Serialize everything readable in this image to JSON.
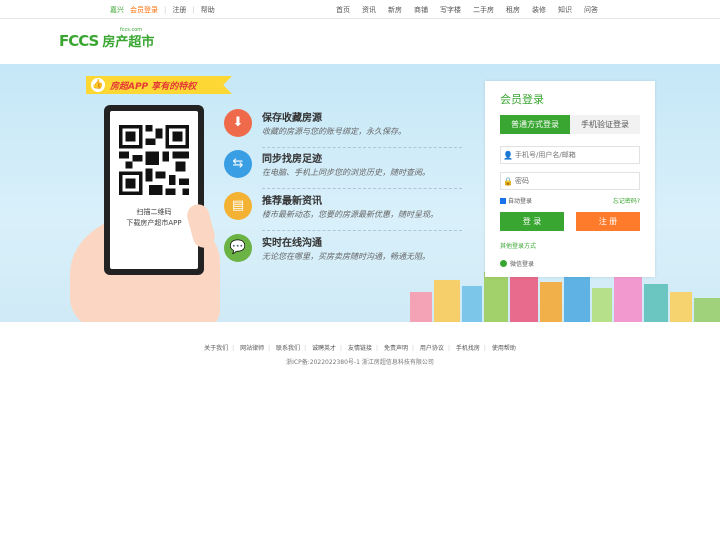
{
  "topbar": {
    "city": "嘉兴",
    "member_login": "会员登录",
    "register": "注册",
    "help": "帮助",
    "nav": [
      "首页",
      "资讯",
      "新房",
      "商铺",
      "写字楼",
      "二手房",
      "租房",
      "装修",
      "知识",
      "问答"
    ]
  },
  "logo": {
    "mark": "FCCS",
    "name": "房产超市",
    "domain": "fccs.com"
  },
  "banner": {
    "promo": "房超APP 享有的特权",
    "qr_caption_1": "扫描二维码",
    "qr_caption_2": "下载房产超市APP",
    "features": [
      {
        "title": "保存收藏房源",
        "desc": "收藏的房源与您的账号绑定，永久保存。",
        "icon": "download-icon",
        "color": "#ef6a4b"
      },
      {
        "title": "同步找房足迹",
        "desc": "在电脑、手机上同步您的浏览历史，随时查阅。",
        "icon": "sync-icon",
        "color": "#3a9ee4"
      },
      {
        "title": "推荐最新资讯",
        "desc": "楼市最新动态，您要的房源最新优惠，随时呈现。",
        "icon": "news-icon",
        "color": "#f3b233"
      },
      {
        "title": "实时在线沟通",
        "desc": "无论您在哪里，买房卖房随时沟通，畅通无阻。",
        "icon": "chat-icon",
        "color": "#6ab344"
      }
    ]
  },
  "login": {
    "title": "会员登录",
    "tab_normal": "普通方式登录",
    "tab_phone": "手机验证登录",
    "username_placeholder": "手机号/用户名/邮箱",
    "password_placeholder": "密码",
    "auto_login": "自动登录",
    "forgot": "忘记密码?",
    "login_btn": "登 录",
    "register_btn": "注 册",
    "other": "其他登录方式",
    "wechat": "微信登录"
  },
  "footer": {
    "links": [
      "关于我们",
      "网站律师",
      "联系我们",
      "诚聘英才",
      "友情链接",
      "免责声明",
      "用户协议",
      "手机找房",
      "使用帮助"
    ],
    "icp": "浙ICP备:2022022380号-1 浙江房超信息科技有限公司"
  },
  "colors": {
    "brand": "#3aa632",
    "orange": "#ff7b2c"
  }
}
